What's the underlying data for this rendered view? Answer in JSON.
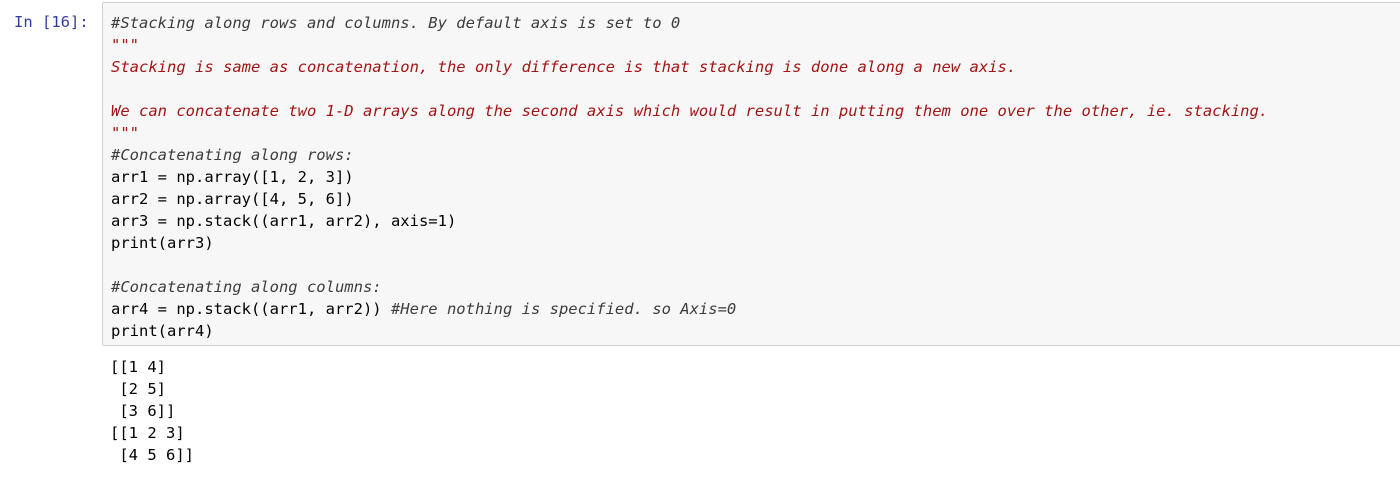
{
  "cell": {
    "prompt": "In [16]:",
    "code_lines": [
      {
        "text": "#Stacking along rows and columns. By default axis is set to 0",
        "kind": "comment"
      },
      {
        "text": "\"\"\"",
        "kind": "string"
      },
      {
        "text": "Stacking is same as concatenation, the only difference is that stacking is done along a new axis.",
        "kind": "string"
      },
      {
        "text": "",
        "kind": "string"
      },
      {
        "text": "We can concatenate two 1-D arrays along the second axis which would result in putting them one over the other, ie. stacking.",
        "kind": "string"
      },
      {
        "text": "\"\"\"",
        "kind": "string"
      },
      {
        "text": "#Concatenating along rows:",
        "kind": "comment"
      },
      {
        "text": "arr1 = np.array([1, 2, 3])",
        "kind": "code"
      },
      {
        "text": "arr2 = np.array([4, 5, 6])",
        "kind": "code"
      },
      {
        "text": "arr3 = np.stack((arr1, arr2), axis=1)",
        "kind": "code"
      },
      {
        "text": "print(arr3)",
        "kind": "code"
      },
      {
        "text": "",
        "kind": "code"
      },
      {
        "text": "#Concatenating along columns:",
        "kind": "comment"
      },
      {
        "text": "arr4 = np.stack((arr1, arr2)) ",
        "kind": "code",
        "trailing_comment": "#Here nothing is specified. so Axis=0"
      },
      {
        "text": "print(arr4)",
        "kind": "code"
      }
    ],
    "output_lines": [
      "[[1 4]",
      " [2 5]",
      " [3 6]]",
      "[[1 2 3]",
      " [4 5 6]]"
    ]
  }
}
